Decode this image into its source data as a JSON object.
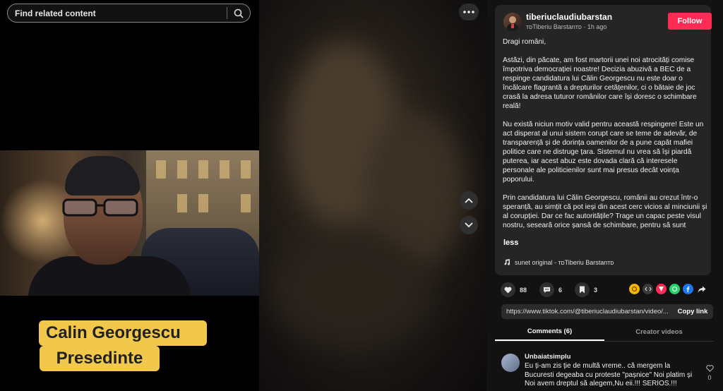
{
  "search": {
    "placeholder": "Find related content"
  },
  "video": {
    "caption_line1": "Calin Georgescu",
    "caption_line2": "Presedinte"
  },
  "author": {
    "username": "tiberiuclaudiubarstan",
    "display_name": "ᴛᴅTiberiu Barstanᴛᴅ",
    "time_ago": "1h ago",
    "follow_label": "Follow"
  },
  "post": {
    "paragraphs": [
      "Dragi români,",
      "Astăzi, din păcate, am fost martorii unei noi atrocități comise împotriva democrației noastre! Decizia abuzivă a BEC de a respinge candidatura lui Călin Georgescu nu este doar o încălcare flagrantă a drepturilor cetățenilor, ci o bătaie de joc crasă la adresa tuturor românilor care își doresc o schimbare reală!",
      "Nu există niciun motiv valid pentru această respingere! Este un act disperat al unui sistem corupt care se teme de adevăr, de transparență și de dorința oamenilor de a pune capăt mafiei politice care ne distruge țara. Sistemul nu vrea să își piardă puterea, iar acest abuz este dovada clară că interesele personale ale politicienilor sunt mai presus decât voința poporului.",
      "Prin candidatura lui Călin Georgescu, românii au crezut într-o speranță, au simțit că pot ieși din acest cerc vicios al minciunii și al corupției. Dar ce fac autoritățile? Trage un capac peste visul nostru, seseară orice șansă de schimbare, pentru să sunt"
    ],
    "less_label": "less",
    "sound": "sunet original - ᴛᴅTiberiu Barstanᴛᴅ"
  },
  "actions": {
    "likes": "88",
    "comments": "6",
    "saves": "3"
  },
  "share": {
    "link": "https://www.tiktok.com/@tiberiuclaudiubarstan/video/...",
    "copy_label": "Copy link"
  },
  "tabs": {
    "comments": "Comments (6)",
    "creator_videos": "Creator videos"
  },
  "comments": [
    {
      "user": "Unbaiatsimplu",
      "text": "Eu ți-am zis ție de multă vreme.. că mergem la Bucuresti degeaba cu proteste \"pașnice\" Noi platim și Noi avem dreptul să alegem,Nu eii.!!! SERIOS.!!!",
      "likes": "0"
    }
  ],
  "colors": {
    "follow": "#fe2c55",
    "caption_bg": "#f1c84b",
    "panel_bg": "#121212",
    "card_bg": "#252525"
  }
}
